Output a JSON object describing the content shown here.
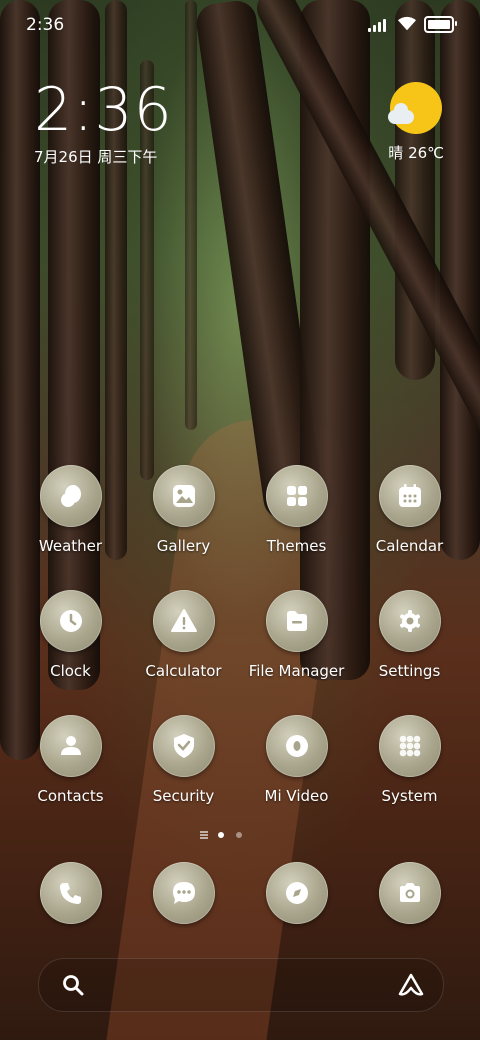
{
  "status_bar": {
    "time": "2:36",
    "icons": [
      "signal-icon",
      "wifi-icon",
      "battery-icon"
    ]
  },
  "clock_widget": {
    "time": "2:36",
    "date": "7月26日 周三下午"
  },
  "weather_widget": {
    "icon": "sun-cloud-icon",
    "text": "晴 26℃",
    "sun_color": "#f7c518"
  },
  "apps": [
    {
      "label": "Weather",
      "icon": "weather-icon"
    },
    {
      "label": "Gallery",
      "icon": "gallery-icon"
    },
    {
      "label": "Themes",
      "icon": "themes-icon"
    },
    {
      "label": "Calendar",
      "icon": "calendar-icon"
    },
    {
      "label": "Clock",
      "icon": "clock-icon"
    },
    {
      "label": "Calculator",
      "icon": "calculator-icon"
    },
    {
      "label": "File Manager",
      "icon": "file-manager-icon"
    },
    {
      "label": "Settings",
      "icon": "settings-icon"
    },
    {
      "label": "Contacts",
      "icon": "contacts-icon"
    },
    {
      "label": "Security",
      "icon": "security-icon"
    },
    {
      "label": "Mi Video",
      "icon": "video-icon"
    },
    {
      "label": "System",
      "icon": "system-folder-icon"
    }
  ],
  "page_indicator": {
    "pages": 2,
    "current": 1
  },
  "dock": [
    {
      "icon": "phone-icon"
    },
    {
      "icon": "messages-icon"
    },
    {
      "icon": "browser-icon"
    },
    {
      "icon": "camera-icon"
    }
  ],
  "search_bar": {
    "left_icon": "search-icon",
    "right_icon": "assistant-icon"
  },
  "theme": {
    "icon_bg": "#a9a58c",
    "icon_glyph": "#ffffff"
  }
}
